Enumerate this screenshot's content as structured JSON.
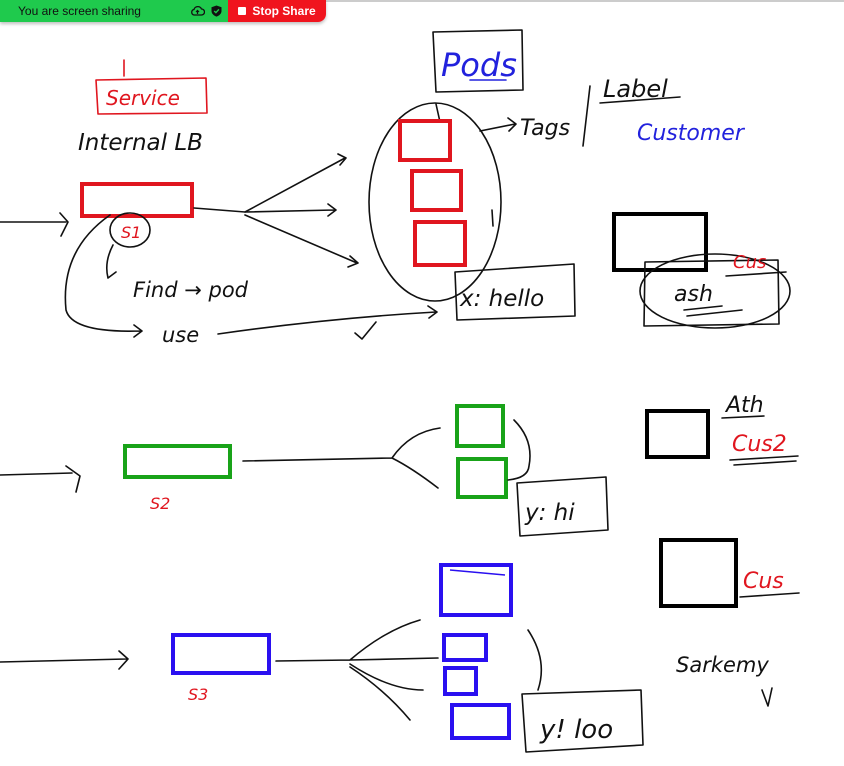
{
  "share_bar": {
    "status_text": "You are screen sharing",
    "stop_label": "Stop Share"
  },
  "whiteboard": {
    "service_label": "Service",
    "internal_lb": "Internal LB",
    "pods_title": "Pods",
    "tags": "Tags",
    "label": "Label",
    "customer": "Customer",
    "s1": "S1",
    "find_pod": "Find → pod",
    "use": "use",
    "x_hello": "x: hello",
    "cus_1": "Cus",
    "ash": "ash",
    "ath": "Ath",
    "cus2": "Cus2",
    "s2": "S2",
    "y_hi": "y: hi",
    "cus_3": "Cus",
    "s3": "S3",
    "y_loo": "y! loo",
    "sarkemy": "Sarkemy"
  },
  "colors": {
    "red": "#e0161f",
    "green": "#19a319",
    "blue": "#2a10f0",
    "black": "#000000",
    "share_green": "#1fca4d",
    "share_red": "#f0141e"
  }
}
